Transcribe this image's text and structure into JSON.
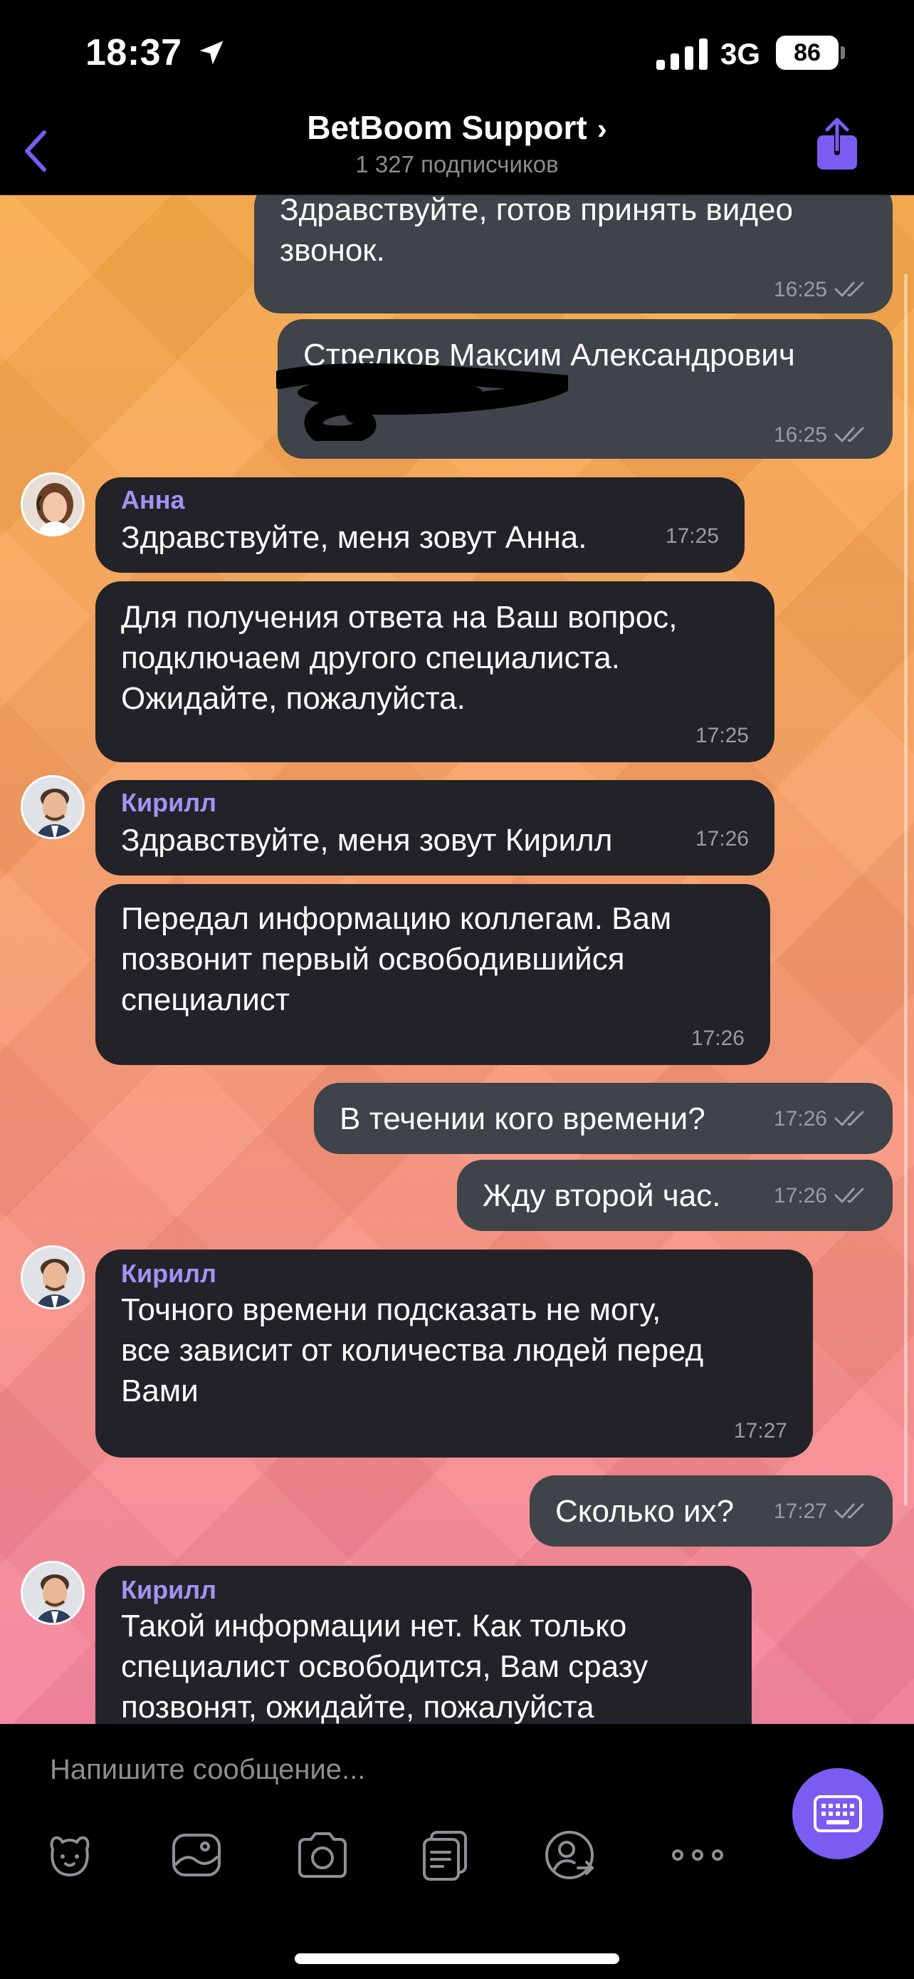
{
  "status_bar": {
    "time": "18:37",
    "network": "3G",
    "battery": "86"
  },
  "header": {
    "title": "BetBoom Support",
    "chevron": "›",
    "subtitle": "1 327 подписчиков"
  },
  "messages": [
    {
      "dir": "out",
      "text": "Здравствуйте, готов принять видео\nзвонок.",
      "time": "16:25",
      "read": true
    },
    {
      "dir": "out",
      "text": "Стрелков Максим Александрович",
      "time": "16:25",
      "read": true
    },
    {
      "dir": "in",
      "sender": "Анна",
      "text": "Здравствуйте, меня зовут Анна.",
      "time": "17:25"
    },
    {
      "dir": "in",
      "text": "Для получения ответа на Ваш вопрос,\nподключаем другого специалиста.\nОжидайте, пожалуйста.",
      "time": "17:25"
    },
    {
      "dir": "in",
      "sender": "Кирилл",
      "text": "Здравствуйте, меня зовут Кирилл",
      "time": "17:26"
    },
    {
      "dir": "in",
      "text": "Передал информацию коллегам. Вам\nпозвонит первый освободившийся\nспециалист",
      "time": "17:26"
    },
    {
      "dir": "out",
      "text": "В течении кого времени?",
      "time": "17:26",
      "read": true
    },
    {
      "dir": "out",
      "text": "Жду второй час.",
      "time": "17:26",
      "read": true
    },
    {
      "dir": "in",
      "sender": "Кирилл",
      "text": "Точного времени подсказать не могу,\nвсе зависит от количества людей перед\nВами",
      "time": "17:27"
    },
    {
      "dir": "out",
      "text": "Сколько их?",
      "time": "17:27",
      "read": true
    },
    {
      "dir": "in",
      "sender": "Кирилл",
      "text": "Такой информации нет. Как только\nспециалист освободится, Вам сразу\nпозвонят, ожидайте, пожалуйста"
    }
  ],
  "composer": {
    "placeholder": "Напишите сообщение...",
    "tools": [
      "sticker-icon",
      "gallery-icon",
      "camera-icon",
      "template-icon",
      "contact-share-icon",
      "more-icon"
    ]
  },
  "colors": {
    "accent": "#7b5cf3",
    "sender_name": "#a293f3",
    "outgoing_bubble": "#3f434a",
    "incoming_bubble": "#212329"
  }
}
